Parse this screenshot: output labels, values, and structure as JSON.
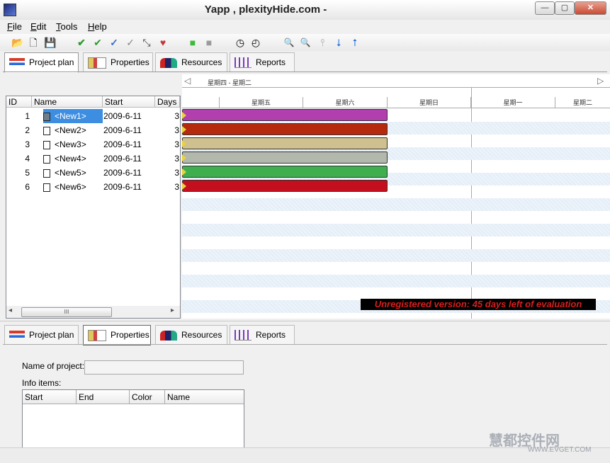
{
  "window": {
    "title": "Yapp , plexityHide.com -",
    "min_glyph": "—",
    "max_glyph": "▢",
    "close_glyph": "✕"
  },
  "menu": [
    "File",
    "Edit",
    "Tools",
    "Help"
  ],
  "toolbar": {
    "icons": [
      "open-folder-icon",
      "new-document-icon",
      "save-icon",
      "check-green-icon",
      "check-double-green-icon",
      "check-blue-icon",
      "check-gray-icon",
      "link-icon",
      "color-palette-icon",
      "green-square-icon",
      "gray-square-icon",
      "clock-icon",
      "clock-alt-icon",
      "zoom-in-icon",
      "zoom-out-icon",
      "marker-icon",
      "arrow-down-icon",
      "arrow-up-icon"
    ],
    "glyphs": [
      "📂",
      "🗋",
      "💾",
      "✔",
      "✔",
      "✓",
      "✓",
      "⤡",
      "♥",
      "■",
      "■",
      "◷",
      "◴",
      "🔍",
      "🔍",
      "⫯",
      "⭣",
      "⭡"
    ]
  },
  "top_tabs": [
    {
      "label": "Project plan",
      "active": true
    },
    {
      "label": "Properties",
      "active": false
    },
    {
      "label": "Resources",
      "active": false
    },
    {
      "label": "Reports",
      "active": false
    }
  ],
  "bottom_tabs": [
    {
      "label": "Project plan",
      "active": false
    },
    {
      "label": "Properties",
      "active": true
    },
    {
      "label": "Resources",
      "active": false
    },
    {
      "label": "Reports",
      "active": false
    }
  ],
  "grid": {
    "columns": [
      "ID",
      "Name",
      "Start",
      "Days"
    ],
    "rows": [
      {
        "id": "1",
        "name": "<New1>",
        "start": "2009-6-11",
        "days": "3"
      },
      {
        "id": "2",
        "name": "<New2>",
        "start": "2009-6-11",
        "days": "3"
      },
      {
        "id": "3",
        "name": "<New3>",
        "start": "2009-6-11",
        "days": "3"
      },
      {
        "id": "4",
        "name": "<New4>",
        "start": "2009-6-11",
        "days": "3"
      },
      {
        "id": "5",
        "name": "<New5>",
        "start": "2009-6-11",
        "days": "3"
      },
      {
        "id": "6",
        "name": "<New6>",
        "start": "2009-6-11",
        "days": "3"
      }
    ],
    "selected_row": 0,
    "scroll_thumb_glyph": "III",
    "scroll_left_glyph": "◂",
    "scroll_right_glyph": "▸"
  },
  "gantt": {
    "range_label": "星期四 - 星期二",
    "day_headers": [
      "星期五",
      "星期六",
      "星期日",
      "星期一",
      "星期二"
    ],
    "nav_left_glyph": "◁",
    "nav_right_glyph": "▷",
    "bar_colors": [
      "#b23fae",
      "#b52a0c",
      "#cfc08f",
      "#b2b8ac",
      "#3fae4f",
      "#c4101e"
    ],
    "watermark_notice": "Unregistered version: 45 days left of evaluation"
  },
  "properties": {
    "name_label": "Name of project:",
    "name_value": "",
    "info_label": "Info items:",
    "info_columns": [
      "Start",
      "End",
      "Color",
      "Name"
    ]
  },
  "watermark": {
    "text": "慧都控件网",
    "url": "WWW.EVGET.COM"
  }
}
